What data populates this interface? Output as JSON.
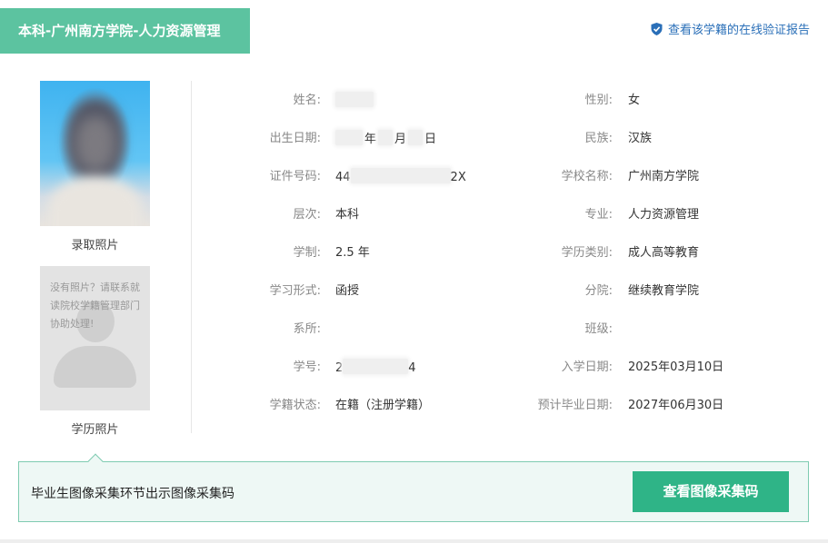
{
  "header": {
    "title": "本科-广州南方学院-人力资源管理",
    "verify_link": "查看该学籍的在线验证报告",
    "accent_color": "#5cc3a0",
    "link_color": "#2a6fb8"
  },
  "photos": {
    "admission_caption": "录取照片",
    "degree_caption": "学历照片",
    "no_photo_note": "没有照片？请联系就读院校学籍管理部门协助处理!"
  },
  "fields_left": [
    {
      "label": "姓名:",
      "value": ""
    },
    {
      "label": "出生日期:",
      "value": "年  月  日"
    },
    {
      "label": "证件号码:",
      "value_prefix": "44",
      "value_suffix": "2X"
    },
    {
      "label": "层次:",
      "value": "本科"
    },
    {
      "label": "学制:",
      "value": "2.5 年"
    },
    {
      "label": "学习形式:",
      "value": "函授"
    },
    {
      "label": "系所:",
      "value": ""
    },
    {
      "label": "学号:",
      "value_prefix": "2",
      "value_suffix": "4"
    },
    {
      "label": "学籍状态:",
      "value": "在籍（注册学籍）"
    }
  ],
  "fields_right": [
    {
      "label": "性别:",
      "value": "女"
    },
    {
      "label": "民族:",
      "value": "汉族"
    },
    {
      "label": "学校名称:",
      "value": "广州南方学院"
    },
    {
      "label": "专业:",
      "value": "人力资源管理"
    },
    {
      "label": "学历类别:",
      "value": "成人高等教育"
    },
    {
      "label": "分院:",
      "value": "继续教育学院"
    },
    {
      "label": "班级:",
      "value": ""
    },
    {
      "label": "入学日期:",
      "value": "2025年03月10日"
    },
    {
      "label": "预计毕业日期:",
      "value": "2027年06月30日"
    }
  ],
  "banner": {
    "text": "毕业生图像采集环节出示图像采集码",
    "button_label": "查看图像采集码",
    "button_color": "#2fb487"
  },
  "icons": {
    "verify": "shield-check-icon"
  }
}
